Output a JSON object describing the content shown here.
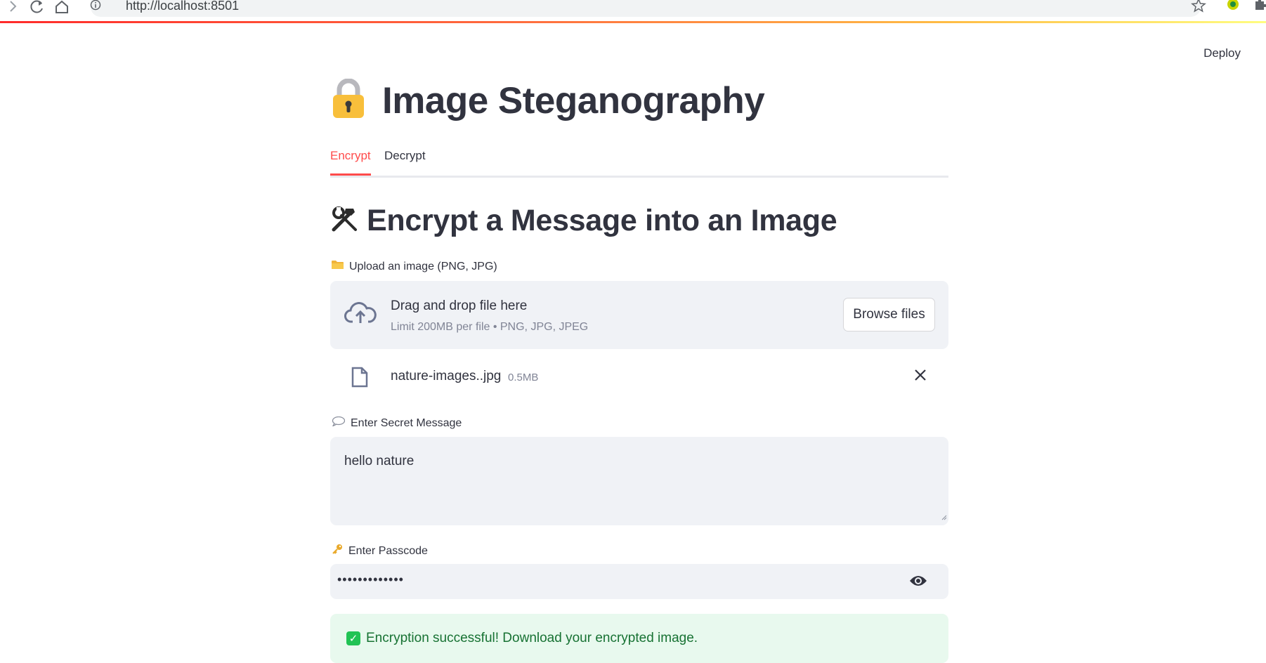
{
  "browser": {
    "url": "http://localhost:8501"
  },
  "header": {
    "deploy_label": "Deploy"
  },
  "app": {
    "title": "Image Steganography",
    "title_icon": "lock-icon"
  },
  "tabs": [
    {
      "label": "Encrypt",
      "active": true
    },
    {
      "label": "Decrypt",
      "active": false
    }
  ],
  "encrypt": {
    "section_title": "Encrypt a Message into an Image",
    "section_icon": "hammer-wrench-icon",
    "upload": {
      "label": "Upload an image (PNG, JPG)",
      "label_icon": "folder-icon",
      "drop_text": "Drag and drop file here",
      "limit_text": "Limit 200MB per file • PNG, JPG, JPEG",
      "browse_label": "Browse files",
      "file_name": "nature-images..jpg",
      "file_size": "0.5MB"
    },
    "message": {
      "label": "Enter Secret Message",
      "label_icon": "speech-bubble-icon",
      "value": "hello nature"
    },
    "passcode": {
      "label": "Enter Passcode",
      "label_icon": "key-icon",
      "value": "•••••••••••••"
    },
    "status": {
      "text": "Encryption successful! Download your encrypted image.",
      "color": "#21c354"
    }
  },
  "colors": {
    "accent": "#ff4b4b",
    "text": "#31333f",
    "input_bg": "#f0f2f6",
    "success_bg": "#e8f9ee",
    "success_text": "#177233"
  }
}
